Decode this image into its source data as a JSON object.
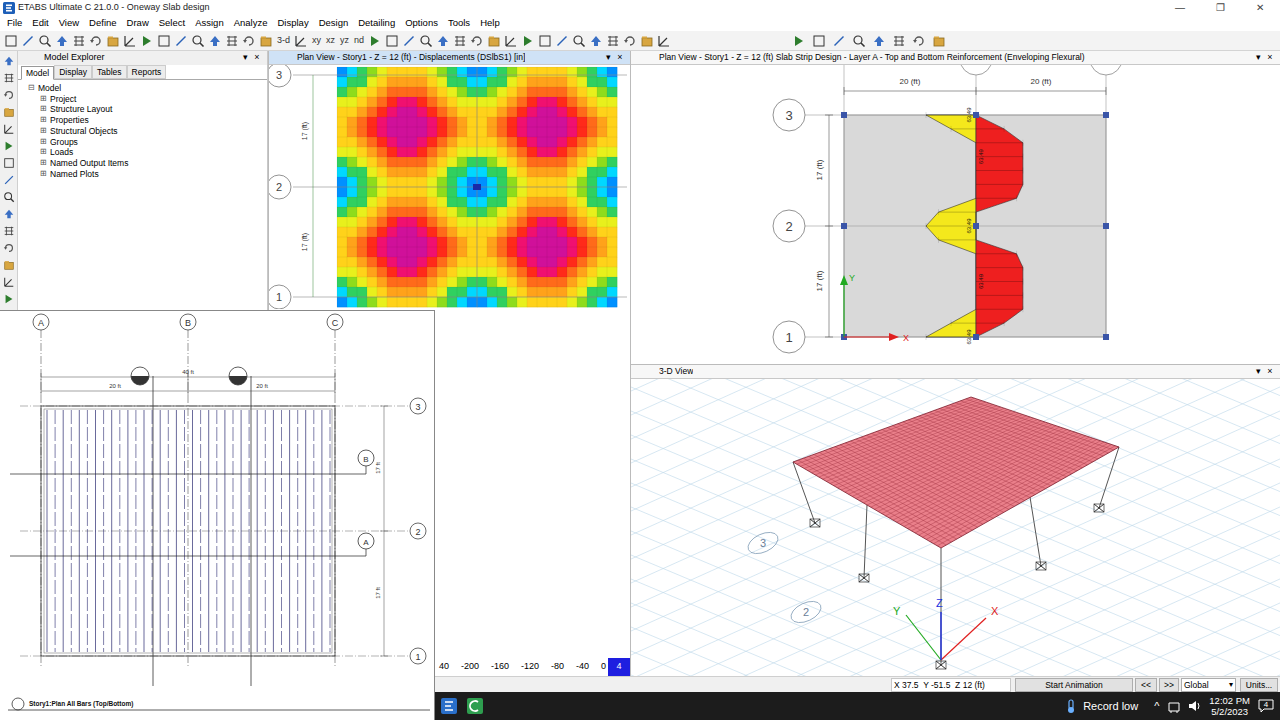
{
  "window": {
    "title": "ETABS Ultimate C 21.0.0 - Oneway Slab design",
    "controls": [
      "—",
      "❐",
      "✕"
    ]
  },
  "menu": [
    "File",
    "Edit",
    "View",
    "Define",
    "Draw",
    "Select",
    "Assign",
    "Analyze",
    "Display",
    "Design",
    "Detailing",
    "Options",
    "Tools",
    "Help"
  ],
  "toolbar": {
    "text_buttons": [
      "3-d",
      "xy",
      "xz",
      "yz",
      "nd"
    ]
  },
  "model_explorer": {
    "title": "Model Explorer",
    "controls": [
      "▾",
      "×"
    ],
    "tabs": [
      {
        "label": "Model",
        "selected": true
      },
      {
        "label": "Display",
        "selected": false
      },
      {
        "label": "Tables",
        "selected": false
      },
      {
        "label": "Reports",
        "selected": false
      }
    ],
    "tree": {
      "root": {
        "label": "Model",
        "glyph": "⊟",
        "expanded": true
      },
      "items": [
        {
          "label": "Project",
          "glyph": "⊞",
          "expanded": false
        },
        {
          "label": "Structure Layout",
          "glyph": "⊞",
          "expanded": false
        },
        {
          "label": "Properties",
          "glyph": "⊞",
          "expanded": false
        },
        {
          "label": "Structural Objects",
          "glyph": "⊞",
          "expanded": false
        },
        {
          "label": "Groups",
          "glyph": "⊞",
          "expanded": false
        },
        {
          "label": "Loads",
          "glyph": "⊞",
          "expanded": false
        },
        {
          "label": "Named Output Items",
          "glyph": "⊞",
          "expanded": false
        },
        {
          "label": "Named Plots",
          "glyph": "⊞",
          "expanded": false
        }
      ]
    }
  },
  "displacement_view": {
    "title": "Plan View - Story1 - Z = 12 (ft) - Displacements (DSlbS1)  [in]",
    "selected": true,
    "controls": [
      "▾",
      "×"
    ],
    "grid_labels": [
      "3",
      "2",
      "1"
    ],
    "dims": [
      "17 (ft)",
      "17 (ft)"
    ],
    "legend": [
      "40",
      "-200",
      "-160",
      "-120",
      "-80",
      "-40",
      "0",
      "4"
    ]
  },
  "strip_view": {
    "title": "Plan View - Story1 - Z = 12 (ft)  Slab Strip Design - Layer A - Top and Bottom Reinforcement (Enveloping Flexural)",
    "selected": false,
    "controls": [
      "▾",
      "×"
    ],
    "top_dims": [
      "20 (ft)",
      "20 (ft)"
    ],
    "side_dims": [
      "17 (ft)",
      "17 (ft)"
    ],
    "grid_labels": [
      "3",
      "2",
      "1"
    ],
    "axes": [
      "Y",
      "X"
    ],
    "series": [
      {
        "kind": "top",
        "color": "#f4e81c",
        "values": [
          1.6,
          0.8,
          0,
          0,
          0,
          0,
          0,
          1.2,
          1.6,
          1.2,
          0,
          0,
          0,
          0,
          0,
          0.8,
          1.6
        ],
        "labels": [
          "63.49",
          "63.49",
          "63.49"
        ]
      },
      {
        "kind": "bottom",
        "color": "#ee1f1f",
        "values": [
          0,
          0.9,
          1.5,
          1.5,
          1.5,
          1.5,
          1.3,
          0,
          0,
          0,
          1.3,
          1.5,
          1.5,
          1.5,
          1.5,
          0.9,
          0
        ],
        "labels": [
          "63.49",
          "63.49"
        ]
      }
    ]
  },
  "view_3d": {
    "title": "3-D View",
    "selected": false,
    "controls": [
      "▾",
      "×"
    ],
    "grid_labels": [
      "2",
      "3"
    ],
    "axes": [
      "X",
      "Y",
      "Z"
    ]
  },
  "cad": {
    "title": "Story1:Plan All Bars (Top/Bottom)",
    "grid_top": [
      "A",
      "B",
      "C"
    ],
    "dims_top": [
      "40 ft",
      "20 ft",
      "20 ft"
    ],
    "grid_right": [
      "3",
      "2",
      "1"
    ],
    "sections": [
      "B",
      "A"
    ],
    "dims_right": [
      "17 ft",
      "17 ft"
    ],
    "bar_count": 36
  },
  "status_bar": {
    "coords": "X 37.5  Y -51.5  Z 12 (ft)",
    "animation": "Start Animation",
    "prev": "<<",
    "next": ">>",
    "system": "Global",
    "system_arrow": "▾",
    "units": "Units..."
  },
  "taskbar": {
    "weather": "Record low",
    "tray_arrow": "^",
    "time": "12:02 PM",
    "date": "5/2/2023",
    "notifications": "4"
  }
}
